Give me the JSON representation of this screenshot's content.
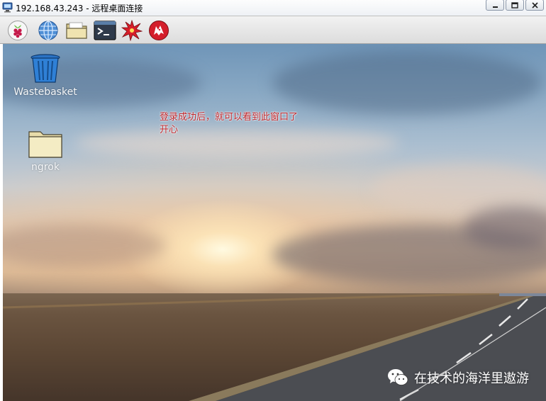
{
  "window": {
    "title": "192.168.43.243 - 远程桌面连接",
    "app_icon": "remote-desktop-icon",
    "buttons": [
      {
        "name": "minimize-button",
        "icon": "minimize-icon"
      },
      {
        "name": "restore-button",
        "icon": "restore-icon"
      },
      {
        "name": "close-button",
        "icon": "close-icon"
      }
    ]
  },
  "panel": {
    "launchers": [
      {
        "name": "raspberry-menu-button",
        "icon": "raspberry-pi-icon"
      },
      {
        "name": "web-browser-button",
        "icon": "globe-icon"
      },
      {
        "name": "file-manager-button",
        "icon": "folder-icon"
      },
      {
        "name": "terminal-button",
        "icon": "terminal-icon"
      },
      {
        "name": "math-kernel-button",
        "icon": "starburst-icon"
      },
      {
        "name": "wolfram-button",
        "icon": "wolf-icon"
      }
    ]
  },
  "desktop": {
    "icons": [
      {
        "label": "Wastebasket",
        "icon": "trash-icon"
      },
      {
        "label": "ngrok",
        "icon": "folder-icon"
      }
    ],
    "annotation": "登录成功后，就可以看到此窗口了\n开心",
    "colors": {
      "annotation": "#c0262b"
    }
  },
  "watermark": {
    "text": "在技术的海洋里遨游",
    "icon": "wechat-icon"
  }
}
